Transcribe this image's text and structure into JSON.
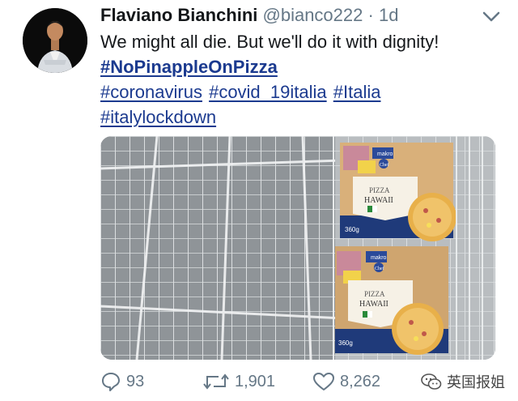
{
  "author": {
    "name": "Flaviano Bianchini",
    "handle": "@bianco222",
    "separator": "·",
    "time": "1d"
  },
  "tweet": {
    "text": "We might all die. But we'll do it with dignity!",
    "hashtags_line1": [
      "#NoPinappleOnPizza"
    ],
    "hashtags_line2": [
      "#coronavirus",
      "#covid_19italia",
      "#Italia"
    ],
    "hashtags_line3": [
      "#italylockdown"
    ]
  },
  "media": {
    "product": {
      "brand": "makro",
      "sub_brand": "Chef",
      "type": "PIZZA",
      "variety": "HAWAII",
      "weight_top": "360g",
      "weight_bottom": "360g"
    }
  },
  "actions": {
    "replies": "93",
    "retweets": "1,901",
    "likes": "8,262"
  },
  "watermark": {
    "text": "英国报姐"
  },
  "icons": {
    "menu": "chevron-down-icon",
    "reply": "reply-icon",
    "retweet": "retweet-icon",
    "like": "heart-icon",
    "watermark": "wechat-icon"
  }
}
